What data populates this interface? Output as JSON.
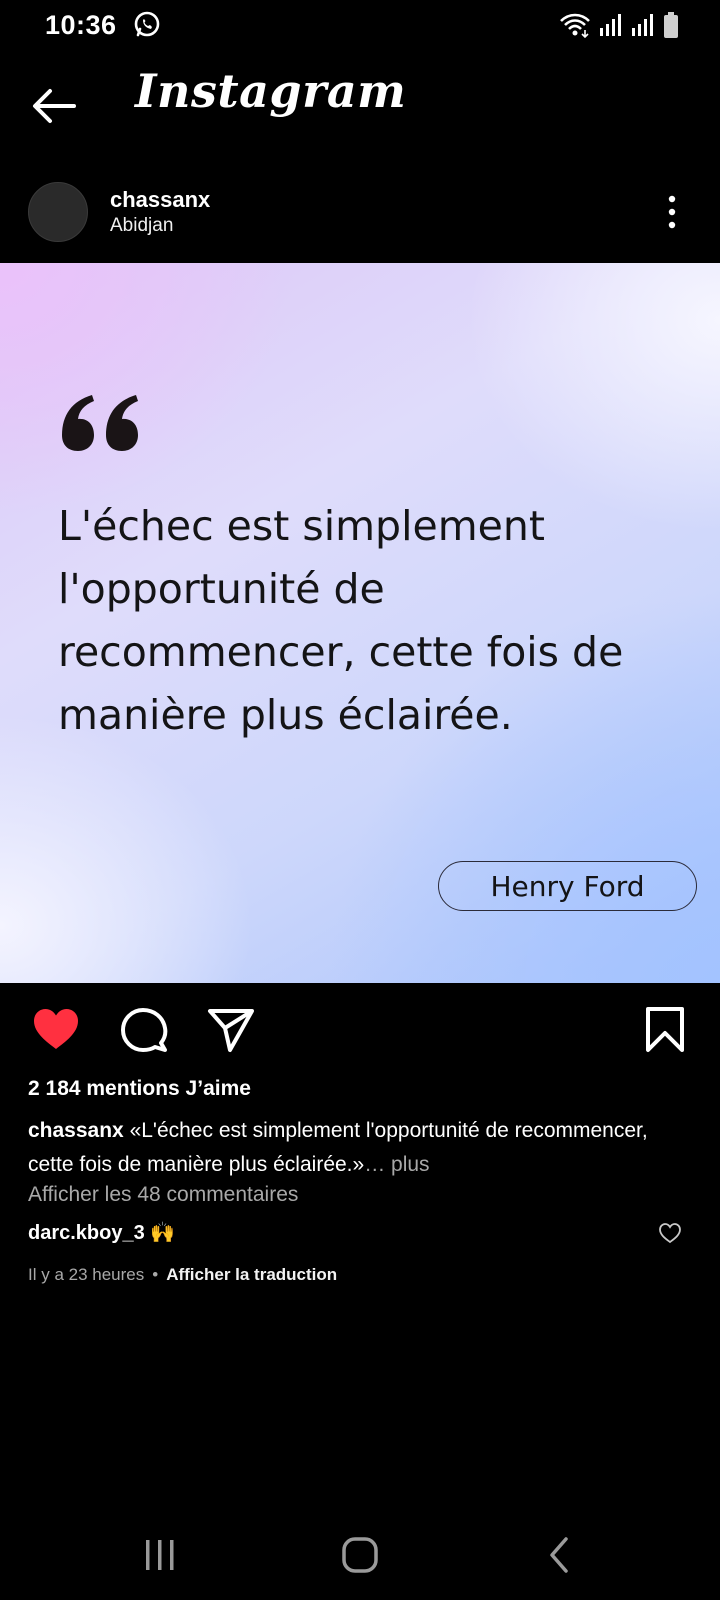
{
  "status_bar": {
    "time": "10:36"
  },
  "header": {
    "title": "Instagram"
  },
  "post": {
    "username": "chassanx",
    "location": "Abidjan",
    "quote": "L'échec est simplement l'opportunité de recommencer, cette fois de manière plus éclairée.",
    "author": "Henry Ford",
    "likes": "2 184 mentions J’aime",
    "caption_user": "chassanx",
    "caption_text": "«L'échec est simplement l'opportunité de recommencer, cette fois de manière plus éclairée.»",
    "caption_more": "… plus",
    "view_comments": "Afficher les 48 commentaires",
    "comment": {
      "user": "darc.kboy_3",
      "emoji": "🙌"
    },
    "time_ago": "Il y a 23 heures",
    "dot": "•",
    "translate": "Afficher la traduction"
  },
  "colors": {
    "like_red": "#ff3040",
    "secondary_text": "#a8a8a8"
  },
  "icons": [
    "whatsapp-icon",
    "wifi-icon",
    "signal-icon",
    "battery-icon",
    "back-arrow-icon",
    "more-icon",
    "heart-icon",
    "comment-icon",
    "share-icon",
    "bookmark-icon"
  ]
}
